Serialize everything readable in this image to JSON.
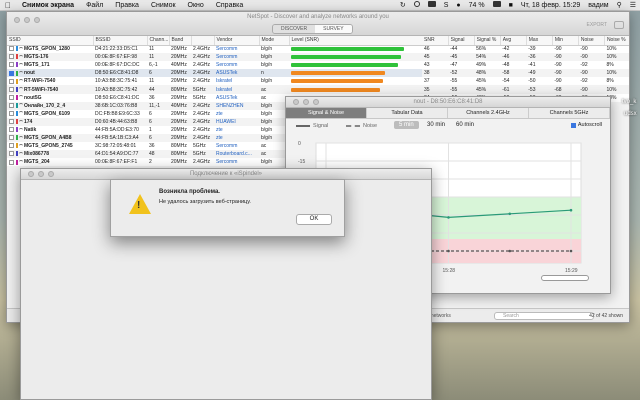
{
  "menubar": {
    "app": "Снимок экрана",
    "items": [
      "Файл",
      "Правка",
      "Снимок",
      "Окно",
      "Справка"
    ],
    "battery": "74 %",
    "datetime": "Чт, 18 февр.  15:29",
    "user": "вадим"
  },
  "main_window": {
    "title": "NetSpot - Discover and analyze networks around you",
    "mode_discover": "DISCOVER",
    "mode_survey": "SURVEY",
    "export": "EXPORT",
    "columns": [
      "SSID",
      "BSSID",
      "Chann...",
      "Band",
      "Vendor",
      "Mode",
      "Level (SNR)"
    ],
    "rows": [
      {
        "ssid": "MGTS_GPON_1280",
        "bssid": "D4:21:22:33:D5:C1",
        "channel": "11",
        "band": "20MHz",
        "freq": "2.4GHz",
        "vendor": "Sercomm",
        "mode": "b/g/n",
        "level": 0.86,
        "color": "g",
        "checked": false
      },
      {
        "ssid": "MGTS-176",
        "bssid": "00:0E:8F:67:EF:98",
        "channel": "11",
        "band": "20MHz",
        "freq": "2.4GHz",
        "vendor": "Sercomm",
        "mode": "b/g/n",
        "level": 0.84,
        "color": "g",
        "checked": false
      },
      {
        "ssid": "MGTS_171",
        "bssid": "00:0E:8F:67:DC:DC",
        "channel": "6,-1",
        "band": "40MHz",
        "freq": "2.4GHz",
        "vendor": "Sercomm",
        "mode": "b/g/n",
        "level": 0.82,
        "color": "g",
        "checked": false
      },
      {
        "ssid": "nout",
        "bssid": "D8:50:E6:C8:41:D8",
        "channel": "6",
        "band": "20MHz",
        "freq": "2.4GHz",
        "vendor": "ASUSTek",
        "mode": "n",
        "level": 0.72,
        "color": "o",
        "checked": true
      },
      {
        "ssid": "RT-WiFi-7540",
        "bssid": "10:A3:B8:3C:75:41",
        "channel": "11",
        "band": "20MHz",
        "freq": "2.4GHz",
        "vendor": "Iskratel",
        "mode": "b/g/n",
        "level": 0.7,
        "color": "o",
        "checked": false
      },
      {
        "ssid": "RT-5WiFi-7540",
        "bssid": "10:A3:B8:3C:75:42",
        "channel": "44",
        "band": "80MHz",
        "freq": "5GHz",
        "vendor": "Iskratel",
        "mode": "ac",
        "level": 0.68,
        "color": "o",
        "checked": false
      },
      {
        "ssid": "nout5G",
        "bssid": "D8:50:E6:C8:41:DC",
        "channel": "36",
        "band": "20MHz",
        "freq": "5GHz",
        "vendor": "ASUSTek",
        "mode": "ac",
        "level": 0.66,
        "color": "o",
        "checked": false
      },
      {
        "ssid": "Онлайн_170_2_4",
        "bssid": "38:6B:1C:03:76:B8",
        "channel": "11,-1",
        "band": "40MHz",
        "freq": "2.4GHz",
        "vendor": "SHENZHEN",
        "mode": "b/g/n",
        "level": 0.6,
        "color": "o",
        "checked": false
      },
      {
        "ssid": "MGTS_GPON_6109",
        "bssid": "DC:FB:B8:E9:6C:33",
        "channel": "6",
        "band": "20MHz",
        "freq": "2.4GHz",
        "vendor": "zte",
        "mode": "b/g/n",
        "level": 0.58,
        "color": "o",
        "checked": false
      },
      {
        "ssid": "174",
        "bssid": "D0:60:4B:44:63:B8",
        "channel": "6",
        "band": "20MHz",
        "freq": "2.4GHz",
        "vendor": "HUAWEI",
        "mode": "b/g/n",
        "level": 0.55,
        "color": "o",
        "checked": false
      },
      {
        "ssid": "Natik",
        "bssid": "44:FB:5A:DD:E3:70",
        "channel": "1",
        "band": "20MHz",
        "freq": "2.4GHz",
        "vendor": "zte",
        "mode": "b/g/n",
        "level": 0.53,
        "color": "o",
        "checked": false
      },
      {
        "ssid": "MGTS_GPON_A4B8",
        "bssid": "44:FB:5A:1B:C3:A4",
        "channel": "6",
        "band": "20MHz",
        "freq": "2.4GHz",
        "vendor": "zte",
        "mode": "b/g/n",
        "level": 0.5,
        "color": "o",
        "checked": false
      },
      {
        "ssid": "MGTS_GPON5_2745",
        "bssid": "3C:98:72:05:48:01",
        "channel": "36",
        "band": "80MHz",
        "freq": "5GHz",
        "vendor": "Sercomm",
        "mode": "ac",
        "level": 0.47,
        "color": "o",
        "checked": false
      },
      {
        "ssid": "Mix086778",
        "bssid": "64:D1:54:A9:DC:77",
        "channel": "48",
        "band": "80MHz",
        "freq": "5GHz",
        "vendor": "Routerboard.c...",
        "mode": "ac",
        "level": 0.45,
        "color": "o",
        "checked": false
      },
      {
        "ssid": "MGTS_204",
        "bssid": "00:0E:8F:67:EF:F1",
        "channel": "2",
        "band": "20MHz",
        "freq": "2.4GHz",
        "vendor": "Sercomm",
        "mode": "b/g/n",
        "level": 0.4,
        "color": "r",
        "checked": false
      }
    ],
    "right_columns": [
      "SNR",
      "Signal",
      "Signal %",
      "Avg",
      "Max",
      "Min",
      "Noise",
      "Noise %"
    ],
    "right_rows": [
      [
        "46",
        "-44",
        "56%",
        "-42",
        "-39",
        "-90",
        "-90",
        "10%"
      ],
      [
        "45",
        "-45",
        "54%",
        "-46",
        "-36",
        "-90",
        "-90",
        "10%"
      ],
      [
        "43",
        "-47",
        "49%",
        "-48",
        "-41",
        "-90",
        "-92",
        "8%"
      ],
      [
        "38",
        "-52",
        "48%",
        "-58",
        "-49",
        "-90",
        "-90",
        "10%"
      ],
      [
        "37",
        "-55",
        "45%",
        "-54",
        "-50",
        "-90",
        "-92",
        "8%"
      ],
      [
        "35",
        "-55",
        "45%",
        "-61",
        "-53",
        "-68",
        "-90",
        "10%"
      ],
      [
        "34",
        "-56",
        "43%",
        "-56",
        "-50",
        "-69",
        "-90",
        "10%"
      ]
    ],
    "hidden_networks": "er networks",
    "search_placeholder": "Search",
    "count": "42 of 42 shown"
  },
  "detail_window": {
    "title": "nout - D8:50:E6:C8:41:D8",
    "tabs": [
      "Signal & Noise",
      "Tabular Data",
      "Channels 2.4GHz",
      "Channels 5GHz"
    ],
    "legend_signal": "Signal",
    "legend_noise": "Noise",
    "ranges": [
      "5 min",
      "30 min",
      "60 min"
    ],
    "active_range": "5 min",
    "autoscroll": "Autoscroll"
  },
  "chart_data": {
    "type": "line",
    "ylabel": "",
    "ylim": [
      -100,
      0
    ],
    "y_ticks": [
      "0",
      "-15",
      "-30",
      "-45",
      "-60",
      "-75",
      "-90"
    ],
    "x_ticks": [
      "15:27",
      "15:28",
      "15:29"
    ],
    "x": [
      "15:27",
      "15:27:30",
      "15:28",
      "15:28:30",
      "15:29"
    ],
    "series": [
      {
        "name": "Signal",
        "values": [
          -58,
          -57,
          -62,
          -59,
          -56
        ]
      },
      {
        "name": "Noise",
        "values": [
          -90,
          -90,
          -90,
          -90,
          -90
        ]
      }
    ]
  },
  "dialog_window": {
    "title": "Подключение к «iSpindel»"
  },
  "alert": {
    "title": "Возникла проблема.",
    "message": "Не удалось загрузить веб-страницу.",
    "ok": "OK"
  },
  "desktop": {
    "label1": "tvo_k",
    "label2": "udsx"
  }
}
